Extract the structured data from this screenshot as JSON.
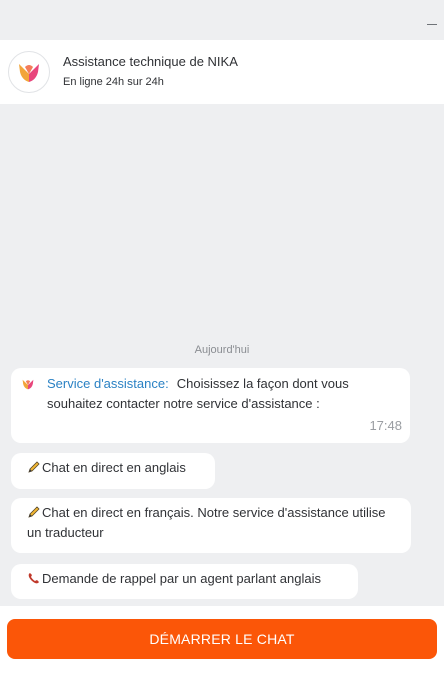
{
  "window": {
    "minimize_icon": "minimize-icon"
  },
  "header": {
    "title": "Assistance technique de NIKA",
    "status": "En ligne 24h sur 24h",
    "avatar_icon": "nika-logo-icon"
  },
  "chat": {
    "date_separator": "Aujourd'hui",
    "message": {
      "sender": "Service d'assistance:",
      "text": "Choisissez la façon dont vous souhaitez contacter notre service d'assistance :",
      "time": "17:48"
    },
    "options": [
      {
        "icon": "pencil-icon",
        "label": "Chat en direct en anglais"
      },
      {
        "icon": "pencil-icon",
        "label": "Chat en direct en français. Notre service d'assistance utilise un traducteur"
      },
      {
        "icon": "phone-icon",
        "label": "Demande de rappel par un agent parlant anglais"
      }
    ]
  },
  "footer": {
    "start_button_label": "DÉMARRER LE CHAT"
  },
  "colors": {
    "accent": "#fb5608",
    "sender": "#2b82c4",
    "background": "#eeeff1"
  }
}
